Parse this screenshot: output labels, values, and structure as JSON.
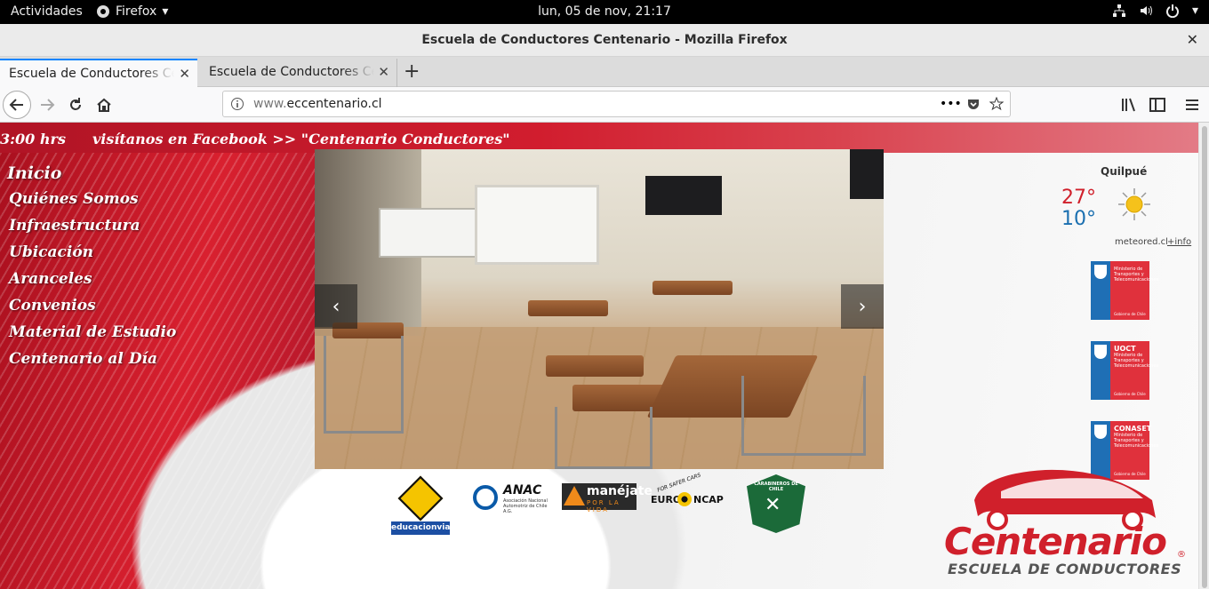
{
  "system": {
    "activities": "Actividades",
    "app_menu": "Firefox",
    "clock": "lun, 05 de nov, 21:17"
  },
  "window": {
    "title": "Escuela de Conductores Centenario - Mozilla Firefox"
  },
  "tabs": [
    {
      "label": "Escuela de Conductores Centenario",
      "active": true
    },
    {
      "label": "Escuela de Conductores Centenario",
      "active": false
    }
  ],
  "urlbar": {
    "prefix": "www.",
    "domain": "eccentenario.cl"
  },
  "site": {
    "ticker": {
      "hours": "3:00 hrs",
      "facebook": "visítanos en Facebook >> \"Centenario Conductores\""
    },
    "menu": [
      "Inicio",
      "Quiénes Somos",
      "Infraestructura",
      "Ubicación",
      "Aranceles",
      "Convenios",
      "Material de Estudio",
      "Centenario al Día"
    ],
    "weather": {
      "city": "Quilpué",
      "high": "27°",
      "low": "10°",
      "source": "meteored.cl",
      "more": "+info"
    },
    "gov_badges": [
      {
        "title": "",
        "text": "Ministerio de Transportes y Telecomunicaciones",
        "footer": "Gobierno de Chile"
      },
      {
        "title": "UOCT",
        "text": "Ministerio de Transportes y Telecomunicaciones",
        "footer": "Gobierno de Chile"
      },
      {
        "title": "CONASET",
        "text": "Ministerio de Transportes y Telecomunicaciones",
        "footer": "Gobierno de Chile"
      }
    ],
    "partner_logos": {
      "educacionvial": "educacionvial.cl",
      "anac_title": "ANAC",
      "anac_sub": "Asociación Nacional Automotriz de Chile A.G.",
      "manejate_title": "manéjate",
      "manejate_sub": "POR LA VIDA",
      "euroncap_left": "EURO",
      "euroncap_right": "NCAP",
      "euroncap_tag": "FOR SAFER CARS",
      "carabineros": "CARABINEROS DE CHILE"
    },
    "brand": {
      "name": "Centenario",
      "registered": "®",
      "subtitle": "ESCUELA DE CONDUCTORES"
    }
  },
  "colors": {
    "brand_red": "#d0202b",
    "tab_accent": "#0a84ff",
    "weather_low": "#1a6fb0"
  }
}
